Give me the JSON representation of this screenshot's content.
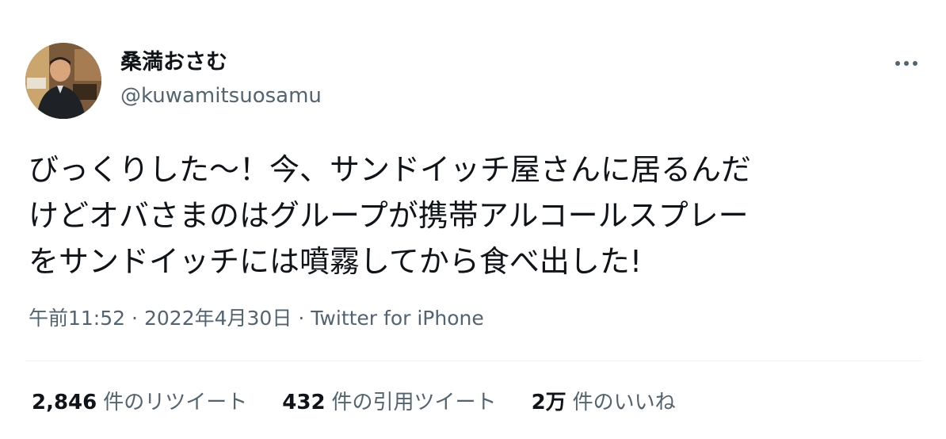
{
  "user": {
    "display_name": "桑満おさむ",
    "handle": "@kuwamitsuosamu"
  },
  "tweet": {
    "lines": [
      "びっくりした〜！今、サンドイッチ屋さんに居るんだ",
      "けどオバさまのはグループが携帯アルコールスプレー",
      "をサンドイッチには噴霧してから食べ出した!"
    ],
    "time": "午前11:52",
    "separator": "·",
    "date": "2022年4月30日",
    "source": "Twitter for iPhone"
  },
  "stats": {
    "retweets": {
      "count": "2,846",
      "label": "件のリツイート"
    },
    "quotes": {
      "count": "432",
      "label": "件の引用ツイート"
    },
    "likes": {
      "count": "2万",
      "label": "件のいいね"
    }
  },
  "icons": {
    "more": "more-horizontal-icon"
  }
}
